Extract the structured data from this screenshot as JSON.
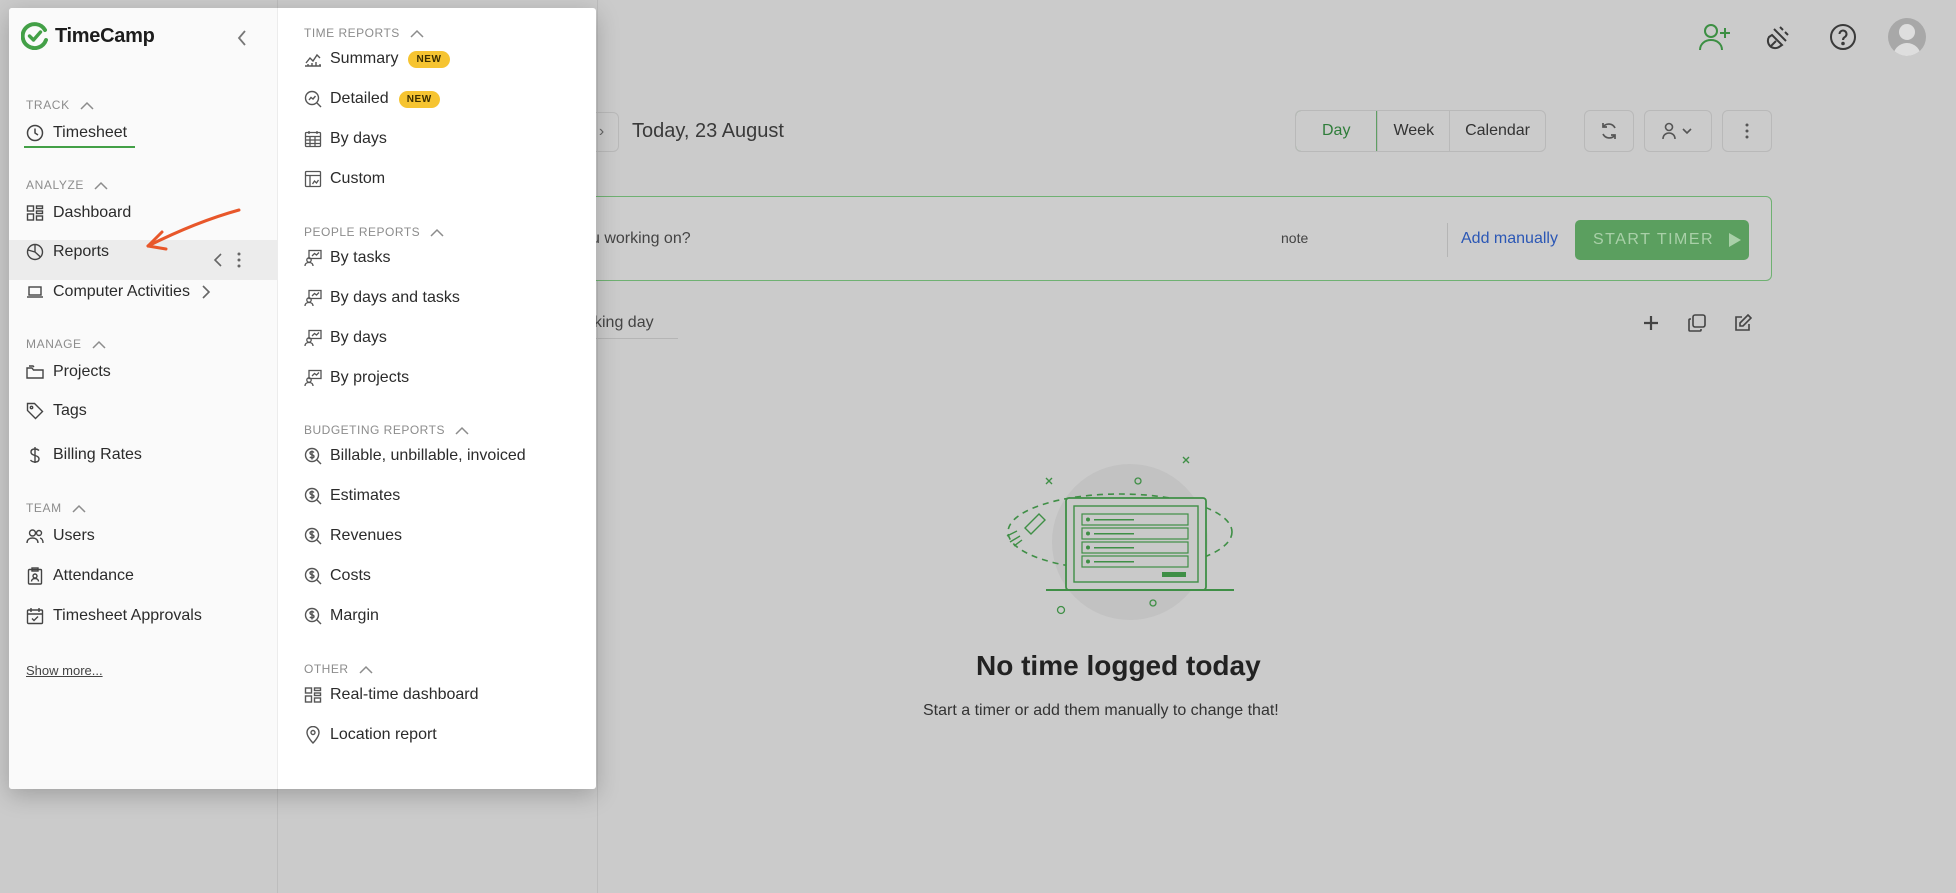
{
  "background": {
    "date_nav_arrow": "›",
    "date_title": "Today, 23 August",
    "view_tabs": [
      "Day",
      "Week",
      "Calendar"
    ],
    "timer": {
      "question": "u working on?",
      "note": "note",
      "add_manually": "Add manually",
      "start_label": "START TIMER"
    },
    "working_day": "king day",
    "empty_title": "No time logged today",
    "empty_subtitle": "Start a timer or add them manually to change that!",
    "top_icons": [
      "add-user-icon",
      "plugin-icon",
      "help-icon",
      "avatar"
    ]
  },
  "menu": {
    "logo_text": "TimeCamp",
    "left": {
      "sections": {
        "track": "TRACK",
        "analyze": "ANALYZE",
        "manage": "MANAGE",
        "team": "TEAM"
      },
      "items": {
        "timesheet": "Timesheet",
        "dashboard": "Dashboard",
        "reports": "Reports",
        "computer_activities": "Computer Activities",
        "projects": "Projects",
        "tags": "Tags",
        "billing_rates": "Billing Rates",
        "users": "Users",
        "attendance": "Attendance",
        "timesheet_approvals": "Timesheet Approvals"
      },
      "show_more": "Show more..."
    },
    "right": {
      "time_reports": {
        "title": "TIME REPORTS",
        "summary": "Summary",
        "detailed": "Detailed",
        "by_days": "By days",
        "custom": "Custom",
        "badge": "NEW"
      },
      "people_reports": {
        "title": "PEOPLE REPORTS",
        "by_tasks": "By tasks",
        "by_days_and_tasks": "By days and tasks",
        "by_days": "By days",
        "by_projects": "By projects"
      },
      "budgeting_reports": {
        "title": "BUDGETING REPORTS",
        "billable": "Billable, unbillable, invoiced",
        "estimates": "Estimates",
        "revenues": "Revenues",
        "costs": "Costs",
        "margin": "Margin"
      },
      "other": {
        "title": "OTHER",
        "realtime_dashboard": "Real-time dashboard",
        "location_report": "Location report"
      }
    }
  },
  "colors": {
    "brand_green": "#43a047",
    "annotation_arrow": "#e8572a",
    "badge_yellow": "#f6c431",
    "link_blue": "#2b57b5"
  }
}
